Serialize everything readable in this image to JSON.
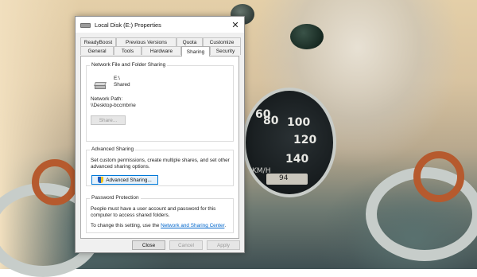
{
  "window": {
    "title": "Local Disk (E:) Properties",
    "close_glyph": "✕"
  },
  "tabs": {
    "row1": [
      "ReadyBoost",
      "Previous Versions",
      "Quota",
      "Customize"
    ],
    "row2": [
      "General",
      "Tools",
      "Hardware",
      "Sharing",
      "Security"
    ],
    "active": "Sharing"
  },
  "network_sharing": {
    "title": "Network File and Folder Sharing",
    "drive_name": "E:\\",
    "drive_status": "Shared",
    "network_path_label": "Network Path:",
    "network_path_value": "\\\\Desktop-bccmbn\\e",
    "share_button": "Share..."
  },
  "advanced_sharing": {
    "title": "Advanced Sharing",
    "description_line1": "Set custom permissions, create multiple shares, and set other",
    "description_line2": "advanced sharing options.",
    "button": "Advanced Sharing..."
  },
  "password_protection": {
    "title": "Password Protection",
    "line1": "People must have a user account and password for this",
    "line2": "computer to access shared folders.",
    "change_prefix": "To change this setting, use the ",
    "link_text": "Network and Sharing Center",
    "change_suffix": "."
  },
  "footer": {
    "close": "Close",
    "cancel": "Cancel",
    "apply": "Apply"
  },
  "wallpaper": {
    "speedometer": {
      "numbers": [
        "80",
        "100",
        "120",
        "140",
        "60"
      ],
      "unit": "KM/H",
      "odometer": "94"
    }
  },
  "colors": {
    "accent": "#0078d7",
    "link": "#0066cc"
  },
  "icons": [
    "drive-icon",
    "uac-shield-icon",
    "close-icon"
  ]
}
